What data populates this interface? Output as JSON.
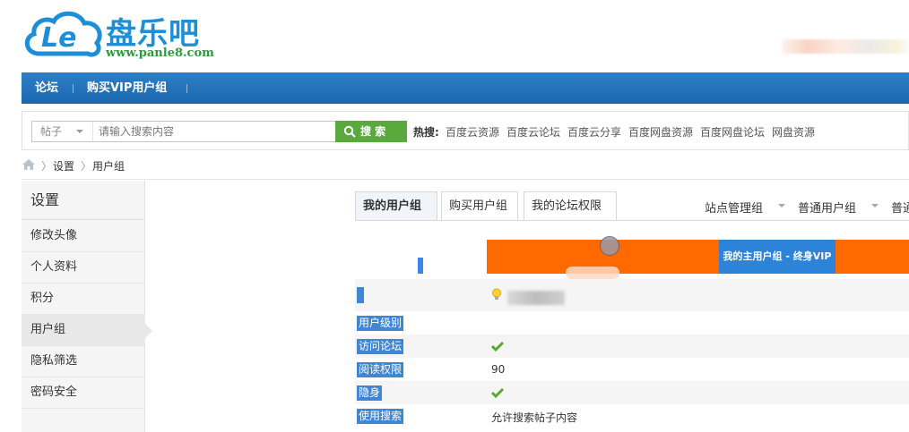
{
  "brand": {
    "name_cn": "盘乐吧",
    "url": "www.panle8.com",
    "logo_letter": "Le"
  },
  "nav": {
    "items": [
      "论坛",
      "购买VIP用户组"
    ]
  },
  "search": {
    "type": "帖子",
    "placeholder": "请输入搜索内容",
    "button": "搜 索"
  },
  "hot": {
    "label": "热搜:",
    "links": [
      "百度云资源",
      "百度云论坛",
      "百度云分享",
      "百度网盘资源",
      "百度网盘论坛",
      "网盘资源"
    ]
  },
  "breadcrumb": {
    "items": [
      "设置",
      "用户组"
    ],
    "sep": "〉"
  },
  "sidebar": {
    "title": "设置",
    "items": [
      "修改头像",
      "个人资料",
      "积分",
      "用户组",
      "隐私筛选",
      "密码安全"
    ],
    "active_index": 3
  },
  "tabs": [
    "我的用户组",
    "购买用户组",
    "我的论坛权限"
  ],
  "groups": [
    "站点管理组",
    "普通用户组",
    "普通"
  ],
  "table": {
    "header_group": "我的主用户组 - 终身VIP",
    "rows": [
      {
        "label": "用户级别",
        "value": ""
      },
      {
        "label": "访问论坛",
        "value": "✔"
      },
      {
        "label": "阅读权限",
        "value": "90"
      },
      {
        "label": "隐身",
        "value": "✔"
      },
      {
        "label": "使用搜索",
        "value": "允许搜索帖子内容"
      }
    ]
  },
  "colors": {
    "nav": "#1f6db5",
    "search_btn": "#59a93c",
    "orange": "#ff6a00",
    "label_blue": "#3f86d5",
    "check_green": "#5aa832"
  }
}
